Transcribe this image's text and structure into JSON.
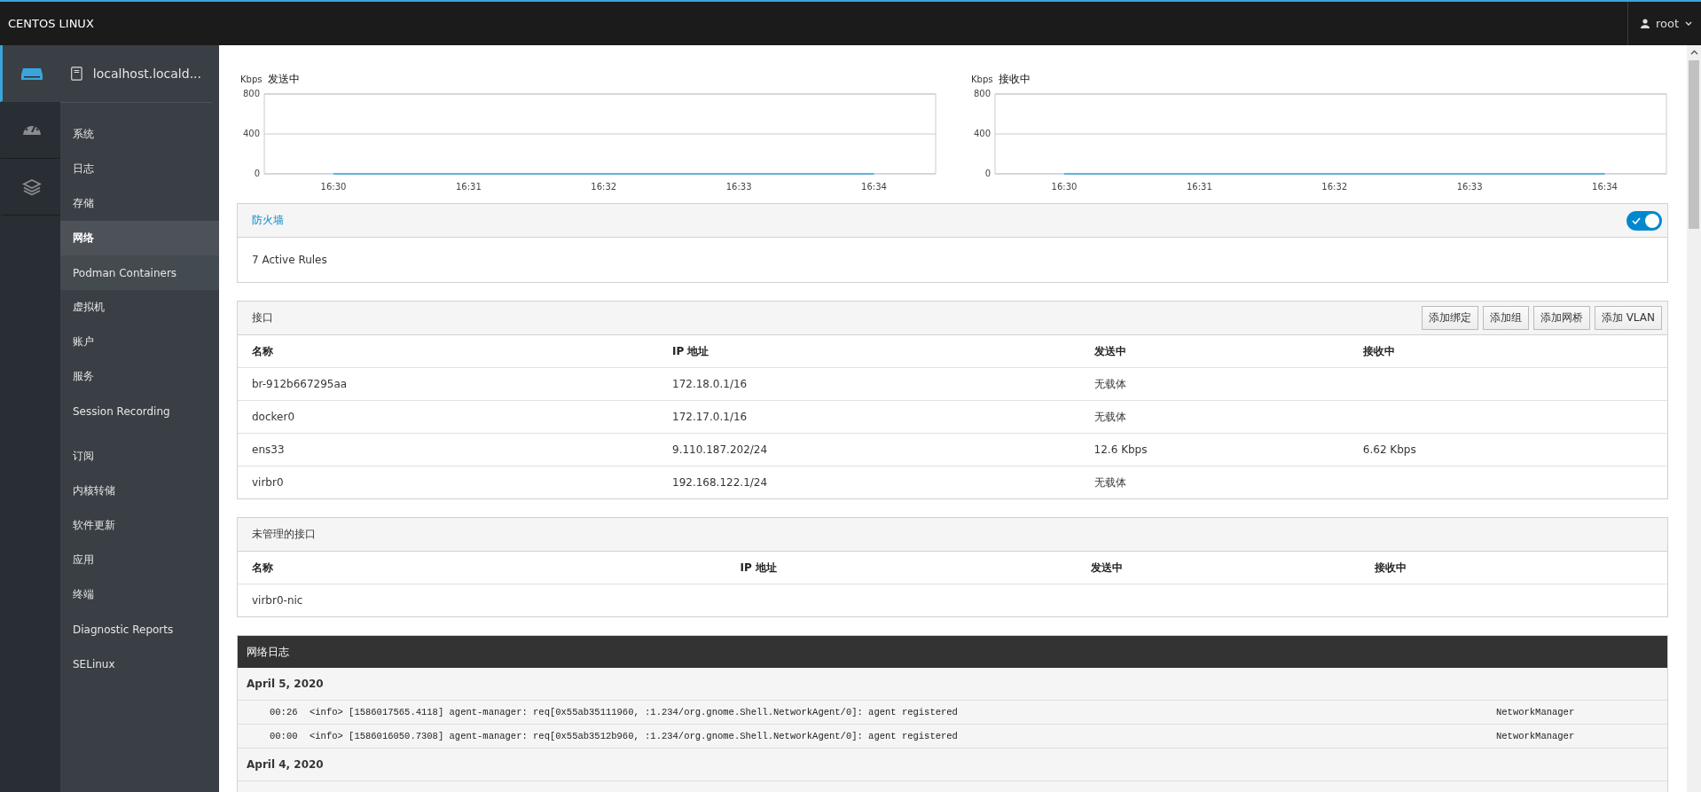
{
  "topbar": {
    "brand": "CENTOS LINUX",
    "user": "root"
  },
  "icon_sidebar": [
    {
      "kind": "host",
      "selected": true
    },
    {
      "kind": "dashboard",
      "selected": false
    },
    {
      "kind": "layers",
      "selected": false
    }
  ],
  "host": {
    "name": "localhost.locald..."
  },
  "nav_groups": [
    {
      "items": [
        {
          "label": "系统",
          "selected": false,
          "hovered": false
        },
        {
          "label": "日志",
          "selected": false,
          "hovered": false
        },
        {
          "label": "存储",
          "selected": false,
          "hovered": false
        },
        {
          "label": "网络",
          "selected": true,
          "hovered": false
        },
        {
          "label": "Podman Containers",
          "selected": false,
          "hovered": true
        },
        {
          "label": "虚拟机",
          "selected": false,
          "hovered": false
        },
        {
          "label": "账户",
          "selected": false,
          "hovered": false
        },
        {
          "label": "服务",
          "selected": false,
          "hovered": false
        },
        {
          "label": "Session Recording",
          "selected": false,
          "hovered": false
        }
      ]
    },
    {
      "items": [
        {
          "label": "订阅",
          "selected": false,
          "hovered": false
        },
        {
          "label": "内核转储",
          "selected": false,
          "hovered": false
        },
        {
          "label": "软件更新",
          "selected": false,
          "hovered": false
        },
        {
          "label": "应用",
          "selected": false,
          "hovered": false
        },
        {
          "label": "终端",
          "selected": false,
          "hovered": false
        },
        {
          "label": "Diagnostic Reports",
          "selected": false,
          "hovered": false
        },
        {
          "label": "SELinux",
          "selected": false,
          "hovered": false
        }
      ]
    }
  ],
  "charts": [
    {
      "chart_data": {
        "type": "line",
        "title": "发送中",
        "ylabel": "Kbps",
        "ylim": [
          0,
          800
        ],
        "yticks": [
          0,
          400,
          800
        ],
        "categories": [
          "16:30",
          "16:31",
          "16:32",
          "16:33",
          "16:34"
        ],
        "series": [
          {
            "color": "#39a5dc",
            "values": [
              0,
              0,
              0,
              0,
              0
            ]
          }
        ]
      }
    },
    {
      "chart_data": {
        "type": "line",
        "title": "接收中",
        "ylabel": "Kbps",
        "ylim": [
          0,
          800
        ],
        "yticks": [
          0,
          400,
          800
        ],
        "categories": [
          "16:30",
          "16:31",
          "16:32",
          "16:33",
          "16:34"
        ],
        "series": [
          {
            "color": "#39a5dc",
            "values": [
              0,
              0,
              0,
              0,
              0
            ]
          }
        ]
      }
    }
  ],
  "firewall": {
    "title": "防火墙",
    "on": true,
    "rules": "7 Active Rules"
  },
  "interfaces": {
    "title": "接口",
    "buttons": [
      "添加绑定",
      "添加组",
      "添加网桥",
      "添加 VLAN"
    ],
    "columns": [
      "名称",
      "IP 地址",
      "发送中",
      "接收中"
    ],
    "rows": [
      [
        "br-912b667295aa",
        "172.18.0.1/16",
        "无载体",
        ""
      ],
      [
        "docker0",
        "172.17.0.1/16",
        "无载体",
        ""
      ],
      [
        "ens33",
        "9.110.187.202/24",
        "12.6 Kbps",
        "6.62 Kbps"
      ],
      [
        "virbr0",
        "192.168.122.1/24",
        "无载体",
        ""
      ]
    ]
  },
  "unmanaged": {
    "title": "未管理的接口",
    "columns": [
      "名称",
      "IP 地址",
      "发送中",
      "接收中"
    ],
    "rows": [
      [
        "virbr0-nic",
        "",
        "",
        ""
      ]
    ]
  },
  "log": {
    "title": "网络日志",
    "days": [
      {
        "date": "April 5, 2020",
        "entries": [
          {
            "time": "00:26",
            "message": "<info> [1586017565.4118] agent-manager: req[0x55ab35111960, :1.234/org.gnome.Shell.NetworkAgent/0]: agent registered",
            "source": "NetworkManager"
          },
          {
            "time": "00:00",
            "message": "<info> [1586016050.7308] agent-manager: req[0x55ab3512b960, :1.234/org.gnome.Shell.NetworkAgent/0]: agent registered",
            "source": "NetworkManager"
          }
        ]
      },
      {
        "date": "April 4, 2020"
      }
    ]
  }
}
